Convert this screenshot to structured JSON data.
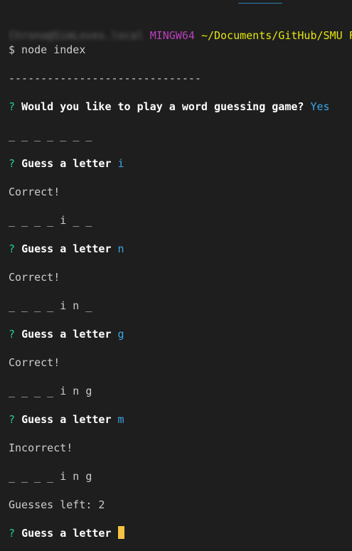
{
  "prompt": {
    "user": "Chrono@SimLoves.local",
    "host": "MINGW64",
    "path": "~/Documents/GitHub/SMU Fu",
    "command": "$ node index"
  },
  "divider": "------------------------------",
  "play_question": {
    "mark": "?",
    "text": "Would you like to play a word guessing game?",
    "answer": "Yes"
  },
  "initial_word": "_ _ _ _ _ _ _",
  "rounds": [
    {
      "mark": "?",
      "prompt": "Guess a letter",
      "guess": "i",
      "result": "Correct!",
      "word": "_ _ _ _ i _ _"
    },
    {
      "mark": "?",
      "prompt": "Guess a letter",
      "guess": "n",
      "result": "Correct!",
      "word": "_ _ _ _ i n _"
    },
    {
      "mark": "?",
      "prompt": "Guess a letter",
      "guess": "g",
      "result": "Correct!",
      "word": "_ _ _ _ i n g"
    },
    {
      "mark": "?",
      "prompt": "Guess a letter",
      "guess": "m",
      "result": "Incorrect!",
      "word": "_ _ _ _ i n g"
    }
  ],
  "guesses_left": "Guesses left: 2",
  "final_prompt": {
    "mark": "?",
    "text": "Guess a letter"
  },
  "colors": {
    "background": "#1e1e1e",
    "question_mark": "#23d18b",
    "answer": "#3ba7e6",
    "host": "#bc3fbc",
    "path": "#e5e510",
    "cursor": "#f6c244"
  }
}
